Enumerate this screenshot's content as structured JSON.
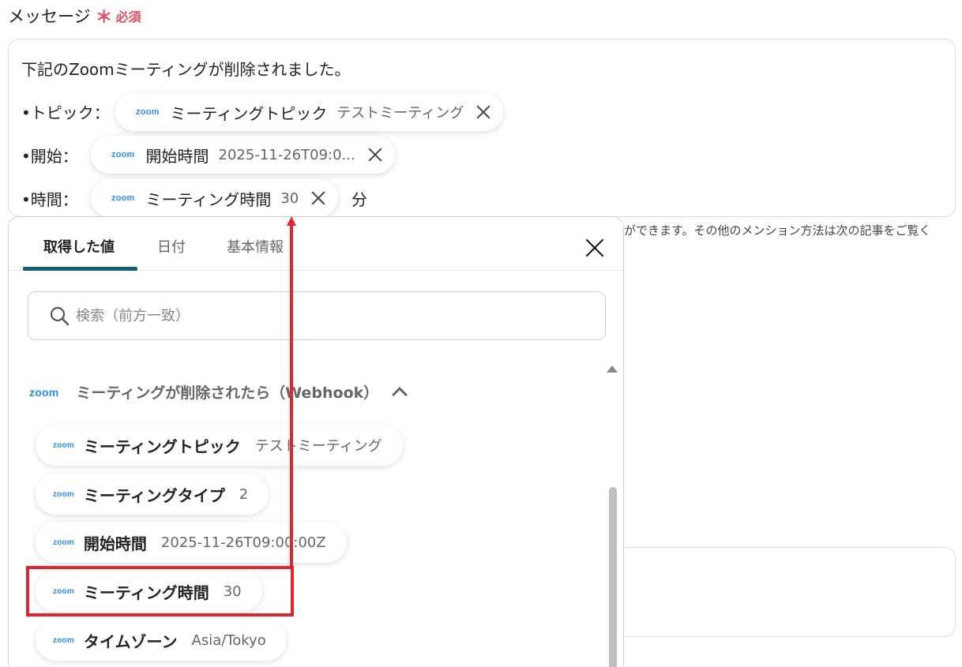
{
  "field": {
    "label": "メッセージ",
    "required_mark": "＊",
    "required_text": "必須"
  },
  "message": {
    "line1": "下記のZoomミーティングが削除されました。",
    "rows": [
      {
        "label": "•トピック：",
        "chip_name": "ミーティングトピック",
        "chip_value": "テストミーティング",
        "suffix": ""
      },
      {
        "label": "•開始：",
        "chip_name": "開始時間",
        "chip_value": "2025-11-26T09:0...",
        "suffix": ""
      },
      {
        "label": "•時間：",
        "chip_name": "ミーティング時間",
        "chip_value": "30",
        "suffix": "分"
      }
    ],
    "zoom_logo": "zoom"
  },
  "help_text": "ができます。その他のメンション方法は次の記事をご覧く",
  "popup": {
    "tabs": [
      "取得した値",
      "日付",
      "基本情報"
    ],
    "active_tab": "取得した値",
    "search_placeholder": "検索（前方一致）",
    "section": {
      "logo": "zoom",
      "title": "ミーティングが削除されたら（Webhook）"
    },
    "items": [
      {
        "name": "ミーティングトピック",
        "value": "テストミーティング"
      },
      {
        "name": "ミーティングタイプ",
        "value": "2"
      },
      {
        "name": "開始時間",
        "value": "2025-11-26T09:00:00Z"
      },
      {
        "name": "ミーティング時間",
        "value": "30"
      },
      {
        "name": "タイムゾーン",
        "value": "Asia/Tokyo"
      }
    ]
  },
  "colors": {
    "required": "#e84a5f",
    "zoom_blue": "#2d8cff",
    "tab_underline": "#155e79",
    "highlight": "#e02531"
  },
  "icons": {
    "search": "search-icon",
    "close": "close-icon",
    "remove": "x-icon",
    "collapse": "chevron-up-icon"
  }
}
